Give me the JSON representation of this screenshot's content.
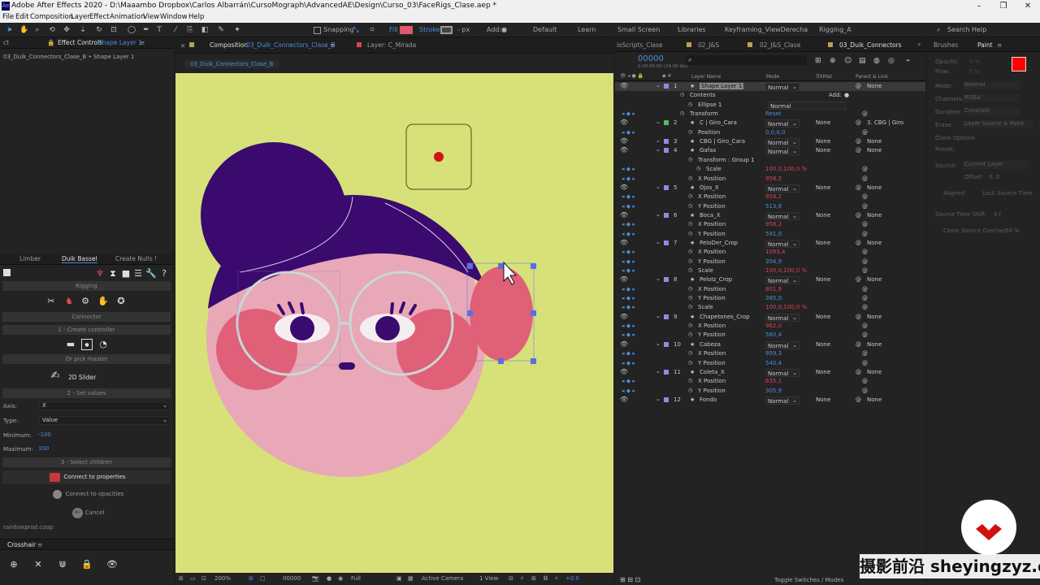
{
  "app": {
    "title": "Adobe After Effects 2020 - D:\\Maaambo Dropbox\\Carlos Albarrán\\CursoMograph\\AdvancedAE\\Design\\Curso_03\\FaceRigs_Clase.aep *"
  },
  "menu": [
    "File",
    "Edit",
    "Composition",
    "Layer",
    "Effect",
    "Animation",
    "View",
    "Window",
    "Help"
  ],
  "toolbar": {
    "snapping": "Snapping",
    "fill": "Fill",
    "stroke": "Stroke",
    "px": "- px",
    "add": "Add:",
    "workspaces": [
      "Default",
      "Learn",
      "Small Screen",
      "Libraries",
      "Keyframing_ViewDerecha",
      "Rigging_A"
    ],
    "search": "Search Help"
  },
  "left": {
    "tabs": {
      "effect_controls": "Effect Controls",
      "effect_layer": "Shape Layer 1"
    },
    "path": "03_Duik_Connectors_Clase_B • Shape Layer 1",
    "duik_tabs": [
      "Limber",
      "Duik Bassel",
      "Create Nulls !"
    ],
    "sections": {
      "rigging": "Rigging",
      "connector": "Connector",
      "create": "1 - Create controller",
      "pick": "Or pick master",
      "set": "2 - Set values",
      "children": "3 - Select children"
    },
    "slider": "2D Slider",
    "axis_label": "Axis:",
    "axis_value": "X",
    "type_label": "Type:",
    "type_value": "Value",
    "min_label": "Minimum:",
    "min_value": "-100",
    "max_label": "Maximum:",
    "max_value": "100",
    "connect_props": "Connect to properties",
    "connect_opac": "Connect to opacities",
    "cancel": "Cancel",
    "credit": "rainboxprod.coop",
    "crosshair": "Crosshair"
  },
  "comp": {
    "tab_label": "Composition",
    "tab_name": "03_Duik_Connectors_Clase_B",
    "tab_layer": "Layer: C_Mirada",
    "breadcrumb": "03_Duik_Connectors_Clase_B",
    "bottom": {
      "zoom": "200%",
      "time": "00000",
      "res": "Full",
      "camera": "Active Camera",
      "view": "1 View",
      "exposure": "+0.0"
    }
  },
  "timeline": {
    "tabs": [
      "ioScripts_Clase",
      "02_J&S",
      "02_J&S_Clase",
      "03_Duik_Connectors"
    ],
    "timecode": "00000",
    "fps": "0:00:00:00 (24.00 fps)",
    "cols": {
      "name": "Layer Name",
      "mode": "Mode",
      "trkmat": "TrkMat",
      "parent": "Parent & Link"
    },
    "footer": "Toggle Switches / Modes",
    "rows": [
      {
        "n": "1",
        "name": "Shape Layer 1",
        "mode": "Normal",
        "trk": "",
        "parent": "None",
        "indent": 0,
        "color": "#8d8de0",
        "sel": true
      },
      {
        "name": "Contents",
        "indent": 1,
        "add": "Add:"
      },
      {
        "name": "Ellipse 1",
        "indent": 2,
        "mode": "Normal"
      },
      {
        "name": "Transform",
        "indent": 1,
        "val": "Reset",
        "vc": "blue"
      },
      {
        "n": "2",
        "name": "C | Giro_Cara",
        "mode": "Normal",
        "trk": "None",
        "parent": "3. CBG | Giro",
        "indent": 0,
        "color": "#5cb85c"
      },
      {
        "name": "Position",
        "indent": 2,
        "val": "0,0,0,0",
        "vc": "blue"
      },
      {
        "n": "3",
        "name": "CBG | Giro_Cara",
        "mode": "Normal",
        "trk": "None",
        "parent": "None",
        "indent": 0,
        "color": "#8d8de0"
      },
      {
        "n": "4",
        "name": "Gafas",
        "mode": "Normal",
        "trk": "None",
        "parent": "None",
        "indent": 0,
        "color": "#8d8de0"
      },
      {
        "name": "Transform : Group 1",
        "indent": 2
      },
      {
        "name": "Scale",
        "indent": 3,
        "val": "100,0,100,0 %",
        "vc": "red"
      },
      {
        "name": "X Position",
        "indent": 2,
        "val": "958,2",
        "vc": "red"
      },
      {
        "n": "5",
        "name": "Ojos_X",
        "mode": "Normal",
        "trk": "None",
        "parent": "None",
        "indent": 0,
        "color": "#8d8de0"
      },
      {
        "name": "X Position",
        "indent": 2,
        "val": "958,2",
        "vc": "red"
      },
      {
        "name": "Y Position",
        "indent": 2,
        "val": "513,8",
        "vc": "blue"
      },
      {
        "n": "6",
        "name": "Boca_X",
        "mode": "Normal",
        "trk": "None",
        "parent": "None",
        "indent": 0,
        "color": "#8d8de0"
      },
      {
        "name": "X Position",
        "indent": 2,
        "val": "958,2",
        "vc": "red"
      },
      {
        "name": "Y Position",
        "indent": 2,
        "val": "591,0",
        "vc": "blue"
      },
      {
        "n": "7",
        "name": "PeloDer_Crop",
        "mode": "Normal",
        "trk": "None",
        "parent": "None",
        "indent": 0,
        "color": "#8d8de0"
      },
      {
        "name": "X Position",
        "indent": 2,
        "val": "1093,4",
        "vc": "red"
      },
      {
        "name": "Y Position",
        "indent": 2,
        "val": "354,9",
        "vc": "blue"
      },
      {
        "name": "Scale",
        "indent": 2,
        "val": "100,0,100,0 %",
        "vc": "red"
      },
      {
        "n": "8",
        "name": "PeloIz_Crop",
        "mode": "Normal",
        "trk": "None",
        "parent": "None",
        "indent": 0,
        "color": "#8d8de0"
      },
      {
        "name": "X Position",
        "indent": 2,
        "val": "801,9",
        "vc": "red"
      },
      {
        "name": "Y Position",
        "indent": 2,
        "val": "385,0",
        "vc": "blue"
      },
      {
        "name": "Scale",
        "indent": 2,
        "val": "100,0,100,0 %",
        "vc": "red"
      },
      {
        "n": "9",
        "name": "Chapetones_Crop",
        "mode": "Normal",
        "trk": "None",
        "parent": "None",
        "indent": 0,
        "color": "#8d8de0"
      },
      {
        "name": "X Position",
        "indent": 2,
        "val": "962,0",
        "vc": "red"
      },
      {
        "name": "Y Position",
        "indent": 2,
        "val": "560,4",
        "vc": "blue"
      },
      {
        "n": "10",
        "name": "Cabeza",
        "mode": "Normal",
        "trk": "None",
        "parent": "None",
        "indent": 0,
        "color": "#8d8de0"
      },
      {
        "name": "X Position",
        "indent": 2,
        "val": "959,3",
        "vc": "blue"
      },
      {
        "name": "Y Position",
        "indent": 2,
        "val": "540,4",
        "vc": "blue"
      },
      {
        "n": "11",
        "name": "Coleta_X",
        "mode": "Normal",
        "trk": "None",
        "parent": "None",
        "indent": 0,
        "color": "#8d8de0"
      },
      {
        "name": "X Position",
        "indent": 2,
        "val": "635,1",
        "vc": "red"
      },
      {
        "name": "Y Position",
        "indent": 2,
        "val": "305,9",
        "vc": "blue"
      },
      {
        "n": "12",
        "name": "Fondo",
        "mode": "Normal",
        "trk": "None",
        "parent": "None",
        "indent": 0,
        "color": "#8d8de0"
      }
    ]
  },
  "right": {
    "tabs": [
      "Brushes",
      "Paint"
    ],
    "labels": [
      "Opacity:",
      "Flow:",
      "Mode:",
      "Channels:",
      "Duration:",
      "Erase:",
      "Clone Options",
      "Preset:",
      "Source:",
      "Offset:",
      "Aligned",
      "Lock Source Time",
      "Source Time Shift:",
      "Clone Source Overlay:"
    ],
    "values": {
      "opacity": "0 %",
      "flow": "0 %",
      "mode": "Normal",
      "channels": "RGBA",
      "duration": "Constant",
      "erase": "Layer Source & Paint",
      "source": "Current Layer",
      "offset": "0, 0",
      "shift": "0 f",
      "overlay": "50 %"
    }
  },
  "colors": {
    "accent": "#2d8ceb",
    "canvas": "#d7e079",
    "hair": "#3a0a6e",
    "skin": "#e8a8b7",
    "cheek": "#e06078",
    "fill_swatch": "#e05870",
    "paint_fg": "#ff0000"
  },
  "watermark": "摄影前沿 sheyingzyz.com"
}
